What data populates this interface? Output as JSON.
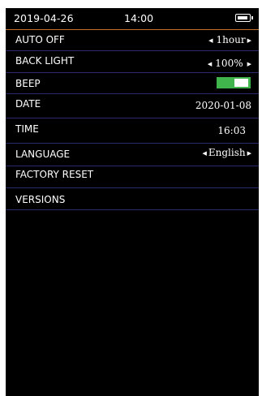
{
  "status_bar": {
    "date": "2019-04-26",
    "time": "14:00",
    "battery_icon": "battery-icon"
  },
  "settings": {
    "auto_off": {
      "label": "AUTO OFF",
      "value": "1hour"
    },
    "backlight": {
      "label": "BACK LIGHT",
      "value": "100%"
    },
    "beep": {
      "label": "BEEP",
      "enabled": true
    },
    "date": {
      "label": "DATE",
      "value": "2020-01-08"
    },
    "time": {
      "label": "TIME",
      "value": "16:03"
    },
    "language": {
      "label": "LANGUAGE",
      "value": "English"
    },
    "factory_reset": {
      "label": "FACTORY RESET"
    },
    "versions": {
      "label": "VERSIONS"
    }
  },
  "glyphs": {
    "left_arrow": "◀",
    "right_arrow": "▶"
  },
  "colors": {
    "background": "#000000",
    "accent_line": "#c5722a",
    "row_divider": "#2a2a6e",
    "toggle_on": "#3fb54b"
  }
}
